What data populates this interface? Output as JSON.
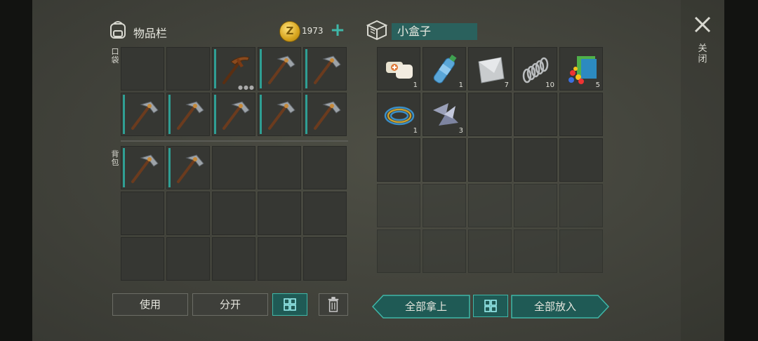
{
  "left_panel": {
    "title": "物品栏",
    "coins": "1973",
    "coin_symbol": "Z",
    "pockets_label": "口袋",
    "backpack_label": "背包",
    "pocket_slots": [
      {
        "item": "empty"
      },
      {
        "item": "empty"
      },
      {
        "item": "pickaxe-rusty",
        "has_menu": true
      },
      {
        "item": "pickaxe"
      },
      {
        "item": "pickaxe"
      },
      {
        "item": "pickaxe"
      },
      {
        "item": "pickaxe"
      },
      {
        "item": "pickaxe"
      },
      {
        "item": "pickaxe"
      },
      {
        "item": "pickaxe"
      }
    ],
    "backpack_slots": [
      {
        "item": "pickaxe"
      },
      {
        "item": "pickaxe"
      },
      {
        "item": "empty"
      },
      {
        "item": "empty"
      },
      {
        "item": "empty"
      },
      {
        "item": "empty"
      },
      {
        "item": "empty"
      },
      {
        "item": "empty"
      },
      {
        "item": "empty"
      },
      {
        "item": "empty"
      },
      {
        "item": "empty"
      },
      {
        "item": "empty"
      },
      {
        "item": "empty"
      },
      {
        "item": "empty"
      },
      {
        "item": "empty"
      }
    ],
    "buttons": {
      "use": "使用",
      "split": "分开"
    }
  },
  "right_panel": {
    "title": "小盒子",
    "items": [
      {
        "item": "bandage-icon",
        "qty": "1"
      },
      {
        "item": "water-bottle-icon",
        "qty": "1"
      },
      {
        "item": "metal-plate-icon",
        "qty": "7"
      },
      {
        "item": "spring-icon",
        "qty": "10"
      },
      {
        "item": "fabric-and-pills-icon",
        "qty": "5"
      },
      {
        "item": "wire-coil-icon",
        "qty": "1"
      },
      {
        "item": "scrap-metal-icon",
        "qty": "3"
      }
    ],
    "buttons": {
      "take_all": "全部拿上",
      "put_all": "全部放入"
    }
  },
  "close": {
    "label": "关闭"
  },
  "colors": {
    "accent": "#3fb7a8",
    "cell": "#363733",
    "coin": "#d6a41e"
  }
}
